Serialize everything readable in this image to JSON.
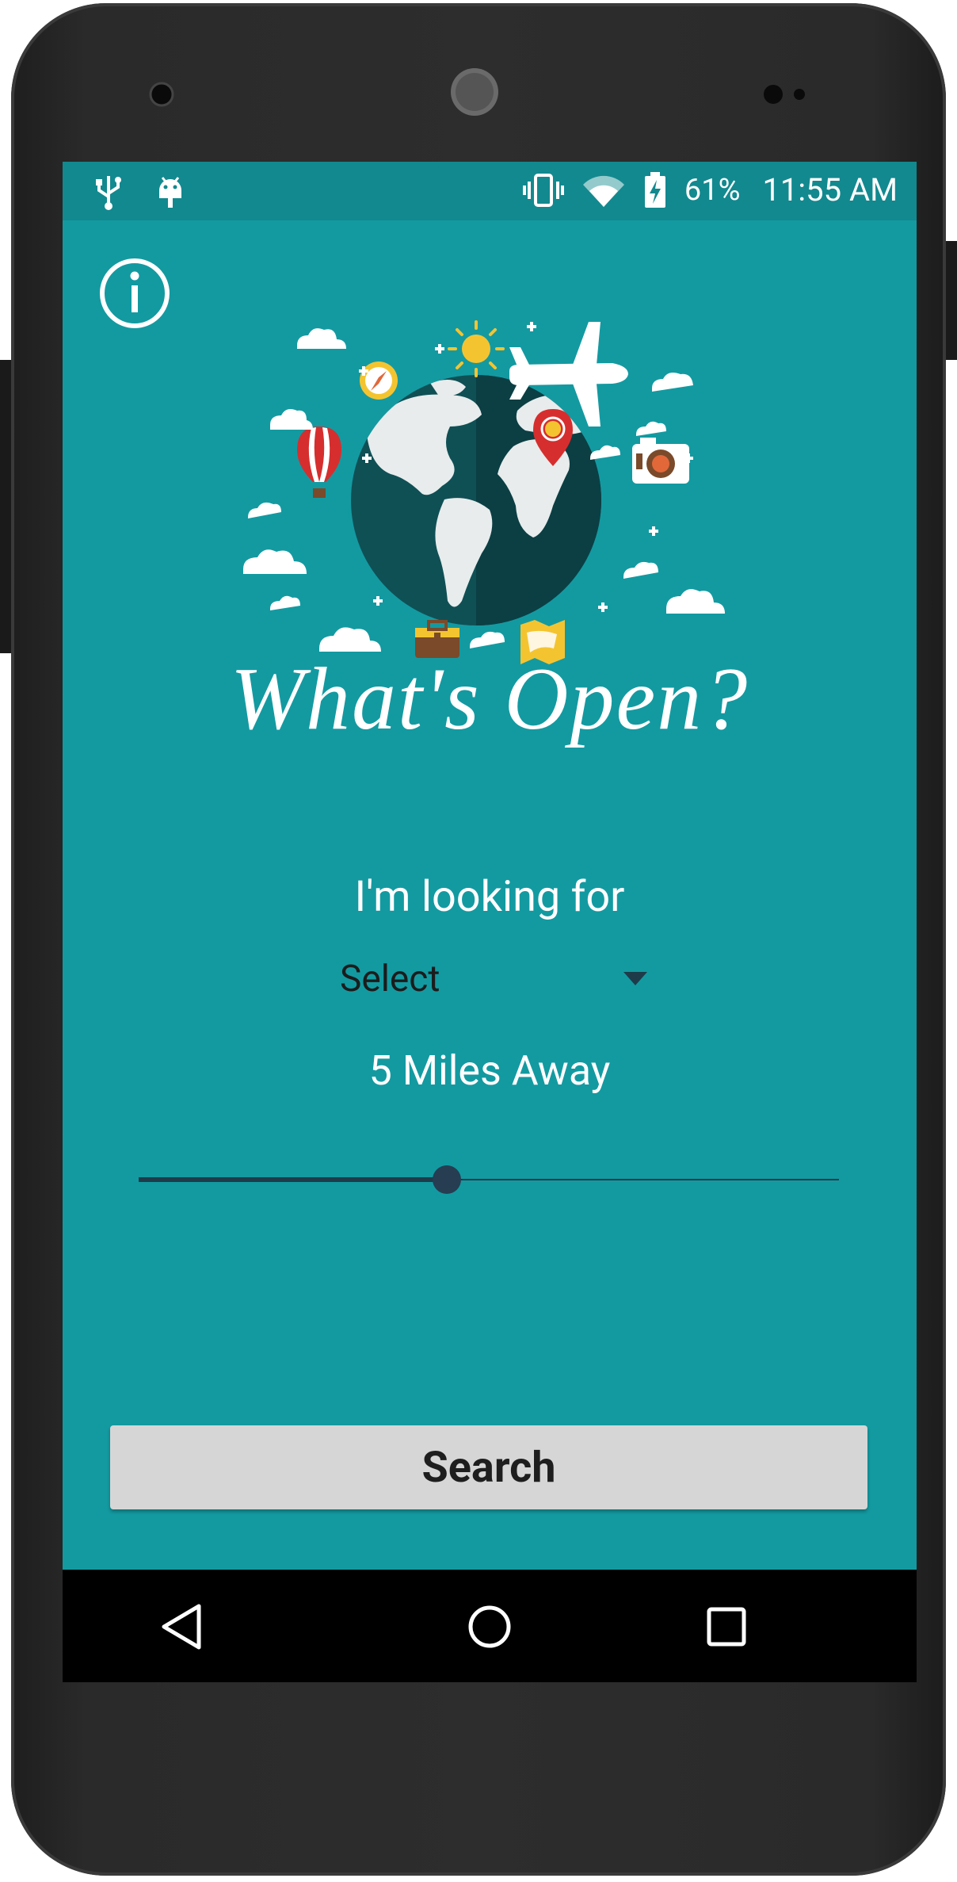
{
  "status_bar": {
    "battery_percent": "61%",
    "time": "11:55 AM",
    "icons": [
      "usb-icon",
      "android-debug-icon",
      "vibrate-icon",
      "wifi-icon",
      "battery-charging-icon"
    ]
  },
  "app": {
    "title": "What's Open?",
    "looking_for_label": "I'm looking for",
    "category_select": {
      "selected": "Select"
    },
    "distance_label": "5 Miles Away",
    "distance_slider": {
      "value_fraction": 0.44
    },
    "search_button_label": "Search"
  },
  "navigation": {
    "buttons": [
      "back-icon",
      "home-icon",
      "recents-icon"
    ]
  },
  "colors": {
    "background": "#139aa1",
    "status_bar": "#12898f",
    "slider": "#1e3b4a",
    "button": "#d6d6d6",
    "globe_dark": "#0c4b4f",
    "accent_yellow": "#f4c430",
    "pin_red": "#d62e2e"
  }
}
